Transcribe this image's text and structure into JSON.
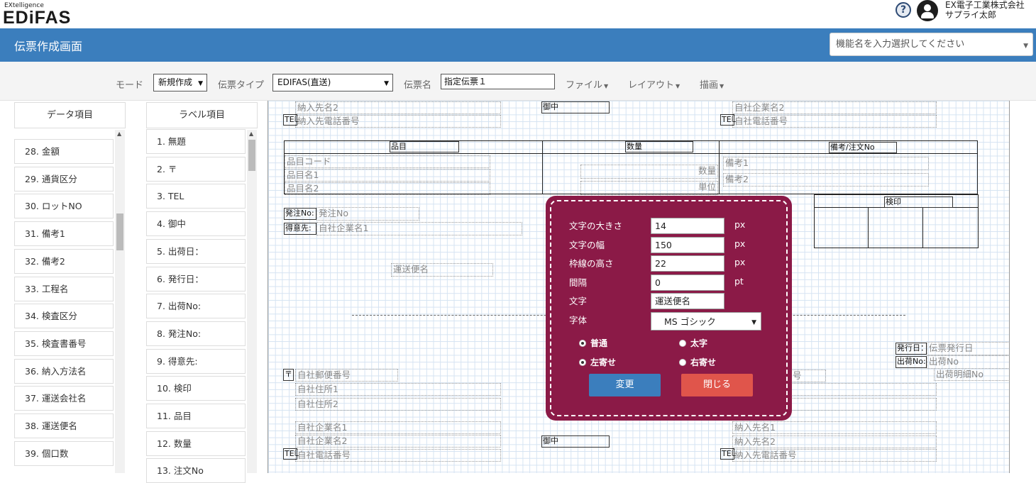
{
  "header": {
    "brand_sub": "EXtelligence",
    "brand": "EDiFAS",
    "help": "?",
    "company": "EX電子工業株式会社",
    "user": "サプライ太郎"
  },
  "titlebar": {
    "title": "伝票作成画面",
    "function_select_placeholder": "機能名を入力選択してください"
  },
  "toolbar": {
    "mode_label": "モード",
    "mode_value": "新規作成",
    "type_label": "伝票タイプ",
    "type_value": "EDIFAS(直送)",
    "name_label": "伝票名",
    "name_value": "指定伝票１",
    "menus": [
      "ファイル",
      "レイアウト",
      "描画"
    ]
  },
  "data_panel": {
    "header": "データ項目",
    "items": [
      "28. 金額",
      "29. 通貨区分",
      "30. ロットNO",
      "31. 備考1",
      "32. 備考2",
      "33. 工程名",
      "34. 検査区分",
      "35. 検査書番号",
      "36. 納入方法名",
      "37. 運送会社名",
      "38. 運送便名",
      "39. 個口数"
    ]
  },
  "label_panel": {
    "header": "ラベル項目",
    "items": [
      "1. 無題",
      "2. 〒",
      "3. TEL",
      "4. 御中",
      "5. 出荷日：",
      "6. 発行日：",
      "7. 出荷No:",
      "8. 発注No:",
      "9. 得意先:",
      "10. 検印",
      "11. 品目",
      "12. 数量",
      "13. 注文No"
    ]
  },
  "canvas": {
    "fields": {
      "dest_name2_top": "納入先名2",
      "dest_tel_top": "納入先電話番号",
      "onchu_top": "御中",
      "own_name2_top": "自社企業名2",
      "own_tel_top": "自社電話番号",
      "item_code": "品目コード",
      "item_name1": "品目名1",
      "item_name2": "品目名2",
      "qty": "数量",
      "unit": "単位",
      "note1": "備考1",
      "note2": "備考2",
      "po_no": "発注No",
      "customer": "自社企業名1",
      "carrier": "運送便名",
      "issue_date": "伝票発行日",
      "ship_no": "出荷No",
      "ship_detail": "出荷明細No",
      "own_zip": "自社郵便番号",
      "own_addr1": "自社住所1",
      "own_addr2": "自社住所2",
      "own_name1_b": "自社企業名1",
      "own_name2_b": "自社企業名2",
      "own_tel_b": "自社電話番号",
      "dest_name1_b": "納入先名1",
      "dest_name2_b": "納入先名2",
      "dest_tel_b": "納入先電話番号",
      "partial_go": "号"
    },
    "labels": {
      "tel": "TEL",
      "onchu": "御中",
      "hinmoku": "品目",
      "suryo": "数量",
      "biko_chumon": "備考/注文No",
      "kenin": "検印",
      "hatchu_no": "発注No:",
      "tokui": "得意先:",
      "issue": "発行日：",
      "ship_no": "出荷No:",
      "zip": "〒"
    }
  },
  "dialog": {
    "font_size_label": "文字の大きさ",
    "font_size_value": "14",
    "text_width_label": "文字の幅",
    "text_width_value": "150",
    "frame_height_label": "枠線の高さ",
    "frame_height_value": "22",
    "spacing_label": "間隔",
    "spacing_value": "0",
    "text_label": "文字",
    "text_value": "運送便名",
    "font_label": "字体",
    "font_value": "MS ゴシック",
    "unit_px": "px",
    "unit_pt": "pt",
    "radio_normal": "普通",
    "radio_bold": "太字",
    "radio_left": "左寄せ",
    "radio_right": "右寄せ",
    "change_button": "変更",
    "close_button": "閉じる"
  }
}
